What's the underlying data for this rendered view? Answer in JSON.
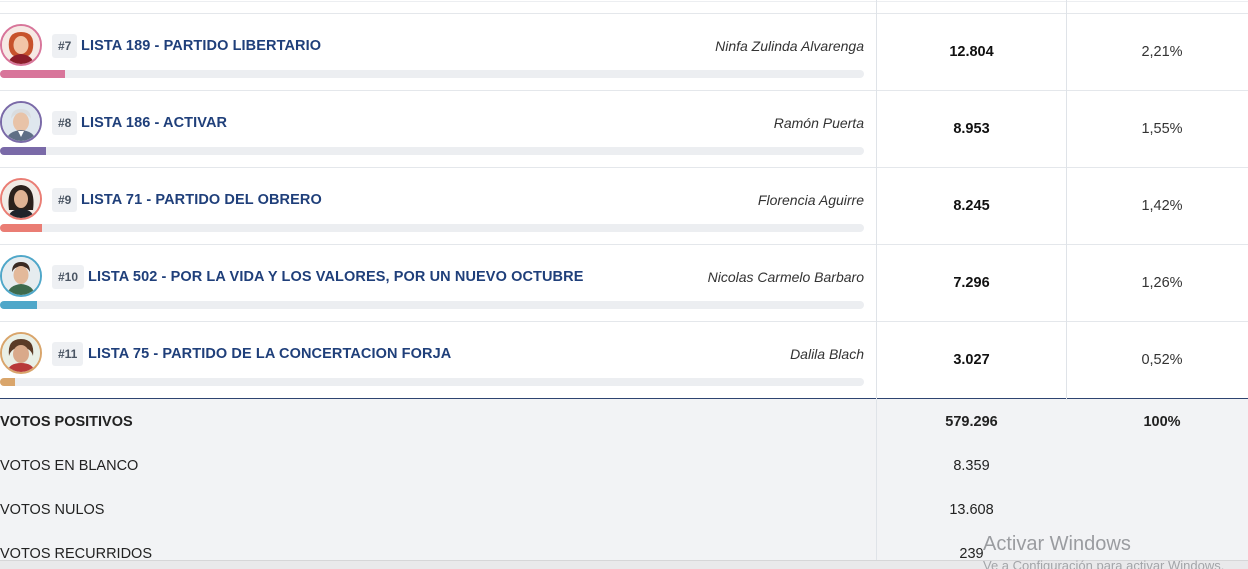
{
  "parties": [
    {
      "rank": "#7",
      "name": "LISTA 189 - PARTIDO LIBERTARIO",
      "candidate": "Ninfa Zulinda Alvarenga",
      "votes": "12.804",
      "percent": "2,21%",
      "percent_value": 2.21,
      "color": "#d8759a",
      "avatar_icon": "candidate-photo-icon"
    },
    {
      "rank": "#8",
      "name": "LISTA 186 - ACTIVAR",
      "candidate": "Ramón Puerta",
      "votes": "8.953",
      "percent": "1,55%",
      "percent_value": 1.55,
      "color": "#7a6aa8",
      "avatar_icon": "candidate-photo-icon"
    },
    {
      "rank": "#9",
      "name": "LISTA 71 - PARTIDO DEL OBRERO",
      "candidate": "Florencia Aguirre",
      "votes": "8.245",
      "percent": "1,42%",
      "percent_value": 1.42,
      "color": "#ea7d74",
      "avatar_icon": "candidate-photo-icon"
    },
    {
      "rank": "#10",
      "name": "LISTA 502 - POR LA VIDA Y LOS VALORES, POR UN NUEVO OCTUBRE",
      "candidate": "Nicolas Carmelo Barbaro",
      "votes": "7.296",
      "percent": "1,26%",
      "percent_value": 1.26,
      "color": "#4fa7c9",
      "avatar_icon": "candidate-photo-icon"
    },
    {
      "rank": "#11",
      "name": "LISTA 75 - PARTIDO DE LA CONCERTACION FORJA",
      "candidate": "Dalila Blach",
      "votes": "3.027",
      "percent": "0,52%",
      "percent_value": 0.52,
      "color": "#d9a56b",
      "avatar_icon": "candidate-photo-icon"
    }
  ],
  "summary": {
    "positive_label": "VOTOS POSITIVOS",
    "positive_votes": "579.296",
    "positive_percent": "100%",
    "blank_label": "VOTOS EN BLANCO",
    "blank_votes": "8.359",
    "null_label": "VOTOS NULOS",
    "null_votes": "13.608",
    "contested_label": "VOTOS RECURRIDOS",
    "contested_votes": "239"
  },
  "watermark": {
    "title": "Activar Windows",
    "subtitle": "Ve a Configuración para activar Windows."
  },
  "colors": {
    "title_blue": "#1f3f7a",
    "summary_bg": "#f2f3f5",
    "summary_border": "#2e4470"
  }
}
